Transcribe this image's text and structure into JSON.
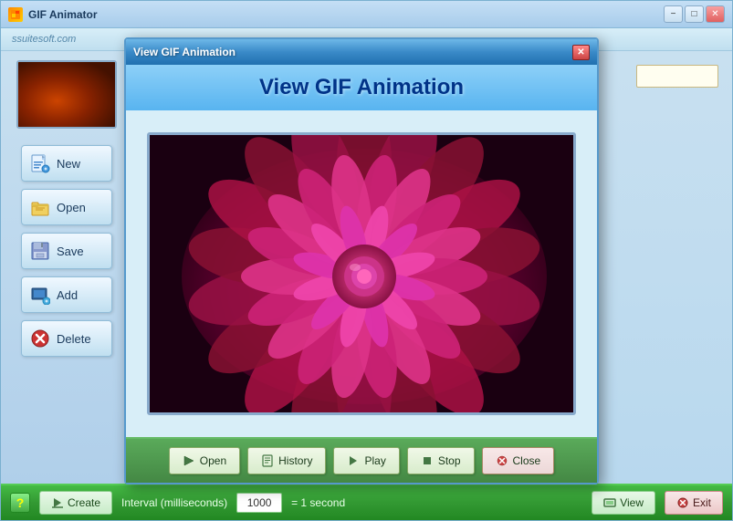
{
  "app": {
    "title": "GIF Animator",
    "company": "ssuitesoft.com"
  },
  "titlebar": {
    "minimize_label": "−",
    "maximize_label": "□",
    "close_label": "✕"
  },
  "sidebar": {
    "buttons": [
      {
        "id": "new",
        "label": "New",
        "icon": "🖼"
      },
      {
        "id": "open",
        "label": "Open",
        "icon": "📂"
      },
      {
        "id": "save",
        "label": "Save",
        "icon": "💾"
      },
      {
        "id": "add",
        "label": "Add",
        "icon": "🖥"
      },
      {
        "id": "delete",
        "label": "Delete",
        "icon": "❌"
      }
    ]
  },
  "modal": {
    "title": "View GIF Animation",
    "header_title": "View GIF Animation",
    "close_label": "✕",
    "footer_buttons": [
      {
        "id": "open",
        "label": "Open",
        "icon": "↗"
      },
      {
        "id": "history",
        "label": "History",
        "icon": "📋"
      },
      {
        "id": "play",
        "label": "Play",
        "icon": "▶"
      },
      {
        "id": "stop",
        "label": "Stop",
        "icon": "■"
      },
      {
        "id": "close",
        "label": "Close",
        "icon": "✕"
      }
    ]
  },
  "statusbar": {
    "help_label": "?",
    "create_label": "Create",
    "interval_label": "Interval (milliseconds)",
    "interval_value": "1000",
    "equals_label": "= 1 second",
    "view_label": "View",
    "exit_label": "Exit"
  }
}
